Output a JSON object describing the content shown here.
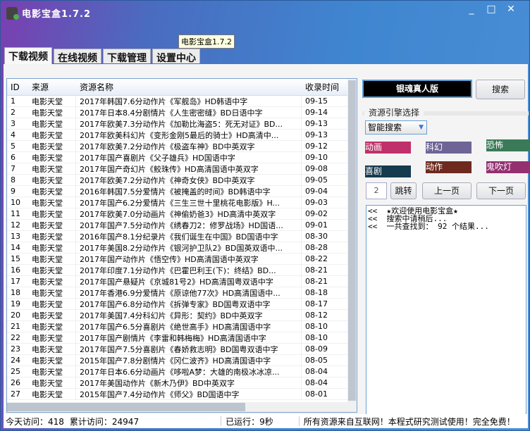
{
  "window": {
    "title": "电影宝盒1.7.2",
    "tooltip": "电影宝盒1.7.2",
    "minimize": "_",
    "maximize": "□",
    "close": "✕"
  },
  "tabs": [
    {
      "label": "下载视频",
      "active": true
    },
    {
      "label": "在线视频"
    },
    {
      "label": "下载管理"
    },
    {
      "label": "设置中心"
    }
  ],
  "table": {
    "columns": [
      "ID",
      "来源",
      "资源名称",
      "收录时间"
    ],
    "rows": [
      [
        "1",
        "电影天堂",
        "2017年韩国7.6分动作片《军舰岛》HD韩语中字",
        "09-15"
      ],
      [
        "2",
        "电影天堂",
        "2017年日本8.4分剧情片《人生密密缝》BD日语中字",
        "09-14"
      ],
      [
        "3",
        "电影天堂",
        "2017年欧美7.3分动作片《加勒比海盗5：死无对证》BD...",
        "09-13"
      ],
      [
        "4",
        "电影天堂",
        "2017年欧美科幻片《变形金刚5最后的骑士》HD高清中...",
        "09-13"
      ],
      [
        "5",
        "电影天堂",
        "2017年欧美7.2分动作片《极盗车神》BD中英双字",
        "09-12"
      ],
      [
        "6",
        "电影天堂",
        "2017年国产喜剧片《父子雄兵》HD国语中字",
        "09-10"
      ],
      [
        "7",
        "电影天堂",
        "2017年国产奇幻片《鲛珠传》HD高清国语中英双字",
        "09-08"
      ],
      [
        "8",
        "电影天堂",
        "2017年欧美7.2分动作片《神奇女侠》BD中英双字",
        "09-05"
      ],
      [
        "9",
        "电影天堂",
        "2016年韩国7.5分爱情片《被掩盖的时间》BD韩语中字",
        "09-04"
      ],
      [
        "10",
        "电影天堂",
        "2017年国产6.2分爱情片《三生三世十里桃花电影版》H...",
        "09-03"
      ],
      [
        "11",
        "电影天堂",
        "2017年欧美7.0分动画片《神偷奶爸3》HD高清中英双字",
        "09-02"
      ],
      [
        "12",
        "电影天堂",
        "2017年国产7.5分动作片《绣春刀2：修罗战场》HD国语...",
        "09-01"
      ],
      [
        "13",
        "电影天堂",
        "2016年国产8.1分纪录片《我们诞生在中国》BD国语中字",
        "08-30"
      ],
      [
        "14",
        "电影天堂",
        "2017年美国8.2分动作片《银河护卫队2》BD国英双语中...",
        "08-28"
      ],
      [
        "15",
        "电影天堂",
        "2017年国产动作片《悟空传》HD高清国语中英双字",
        "08-22"
      ],
      [
        "16",
        "电影天堂",
        "2017年印度7.1分动作片《巴霍巴利王(下)：终结》BD...",
        "08-21"
      ],
      [
        "17",
        "电影天堂",
        "2017年国产悬疑片《京城81号2》HD高清国粤双语中字",
        "08-21"
      ],
      [
        "18",
        "电影天堂",
        "2017年香港6.9分爱情片《原谅他77次》HD高清国语中...",
        "08-18"
      ],
      [
        "19",
        "电影天堂",
        "2017年国产6.8分动作片《拆弹专家》BD国粤双语中字",
        "08-17"
      ],
      [
        "20",
        "电影天堂",
        "2017年美国7.4分科幻片《异形：契约》BD中英双字",
        "08-12"
      ],
      [
        "21",
        "电影天堂",
        "2017年国产6.5分喜剧片《绝世高手》HD高清国语中字",
        "08-10"
      ],
      [
        "22",
        "电影天堂",
        "2017年国产剧情片《李雷和韩梅梅》HD高清国语中字",
        "08-10"
      ],
      [
        "23",
        "电影天堂",
        "2017年国产7.5分喜剧片《春娇救志明》BD国粤双语中字",
        "08-09"
      ],
      [
        "24",
        "电影天堂",
        "2015年国产7.8分剧情片《冈仁波齐》HD高清国语中字",
        "08-05"
      ],
      [
        "25",
        "电影天堂",
        "2017年日本6.6分动画片《哆啦A梦：大雄的南极冰冰凉...",
        "08-04"
      ],
      [
        "26",
        "电影天堂",
        "2017年美国动作片《新木乃伊》BD中英双字",
        "08-04"
      ],
      [
        "27",
        "电影天堂",
        "2015年国产7.4分动作片《师父》BD国语中字",
        "08-01"
      ]
    ]
  },
  "right": {
    "search_value": "银魂真人版",
    "search_button": "搜索",
    "engine_group": "资源引擎选择",
    "engine_selected": "智能搜索",
    "categories": [
      {
        "label": "动画",
        "color": "#c0306a"
      },
      {
        "label": "科幻",
        "color": "#6e6496"
      },
      {
        "label": "恐怖",
        "color": "#3a7a58"
      },
      {
        "label": "喜剧",
        "color": "#163a4e"
      },
      {
        "label": "动作",
        "color": "#6e2a1e"
      },
      {
        "label": "鬼吹灯",
        "color": "#943070"
      }
    ],
    "page_value": "2",
    "jump": "跳转",
    "prev": "上一页",
    "next": "下一页",
    "log": [
      "<<  ★欢迎使用电影宝盒★",
      "<<  搜索中请稍后...",
      "<<  一共查找到： 92 个结果..."
    ]
  },
  "status": {
    "today": "今天访问：418",
    "total": "累计访问：24947",
    "runtime": "已运行：9秒",
    "notice": "所有资源来自互联网！本程式研究测试使用！完全免费！"
  }
}
